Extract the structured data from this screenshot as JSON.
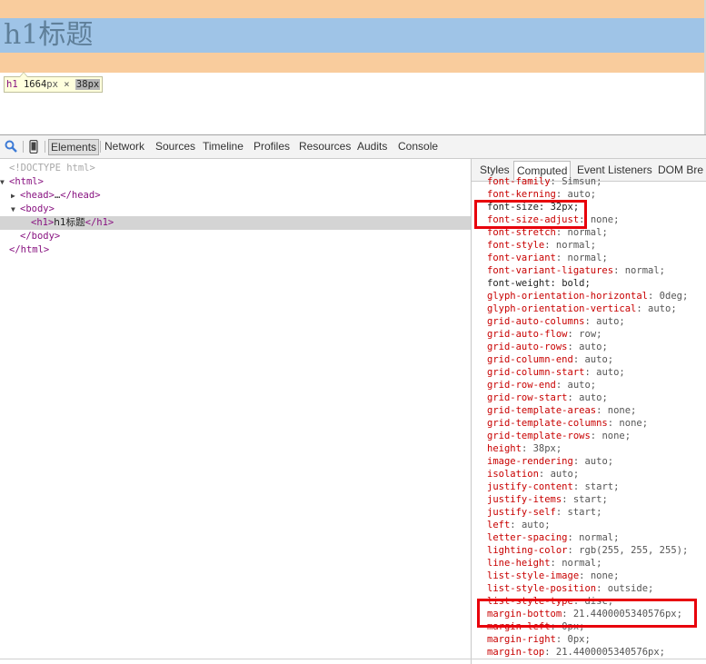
{
  "page": {
    "heading_text": "h1标题",
    "tooltip": {
      "tag": "h1",
      "width_value": "1664",
      "width_unit": "px",
      "times": "×",
      "height_value": "38px"
    }
  },
  "devtools": {
    "toolbar": {
      "tabs": [
        "Elements",
        "Network",
        "Sources",
        "Timeline",
        "Profiles",
        "Resources",
        "Audits",
        "Console"
      ],
      "selected_tab": "Elements"
    },
    "dom_tree": {
      "doctype": "<!DOCTYPE html>",
      "html_open": "<html>",
      "head_open": "<head>",
      "head_ellipsis": "…",
      "head_close": "</head>",
      "body_open": "<body>",
      "h1_open": "<h1>",
      "h1_text": "h1标题",
      "h1_close": "</h1>",
      "body_close": "</body>",
      "html_close": "</html>"
    },
    "sidebar_tabs": [
      "Styles",
      "Computed",
      "Event Listeners",
      "DOM Bre"
    ],
    "selected_sidebar_tab": "Computed",
    "computed_properties": [
      {
        "name": "font-family",
        "value": "Simsun;"
      },
      {
        "name": "font-kerning",
        "value": "auto;"
      },
      {
        "name": "font-size",
        "value": "32px;"
      },
      {
        "name": "font-size-adjust",
        "value": "none;"
      },
      {
        "name": "font-stretch",
        "value": "normal;"
      },
      {
        "name": "font-style",
        "value": "normal;"
      },
      {
        "name": "font-variant",
        "value": "normal;"
      },
      {
        "name": "font-variant-ligatures",
        "value": "normal;"
      },
      {
        "name": "font-weight",
        "value": "bold;"
      },
      {
        "name": "glyph-orientation-horizontal",
        "value": "0deg;"
      },
      {
        "name": "glyph-orientation-vertical",
        "value": "auto;"
      },
      {
        "name": "grid-auto-columns",
        "value": "auto;"
      },
      {
        "name": "grid-auto-flow",
        "value": "row;"
      },
      {
        "name": "grid-auto-rows",
        "value": "auto;"
      },
      {
        "name": "grid-column-end",
        "value": "auto;"
      },
      {
        "name": "grid-column-start",
        "value": "auto;"
      },
      {
        "name": "grid-row-end",
        "value": "auto;"
      },
      {
        "name": "grid-row-start",
        "value": "auto;"
      },
      {
        "name": "grid-template-areas",
        "value": "none;"
      },
      {
        "name": "grid-template-columns",
        "value": "none;"
      },
      {
        "name": "grid-template-rows",
        "value": "none;"
      },
      {
        "name": "height",
        "value": "38px;"
      },
      {
        "name": "image-rendering",
        "value": "auto;"
      },
      {
        "name": "isolation",
        "value": "auto;"
      },
      {
        "name": "justify-content",
        "value": "start;"
      },
      {
        "name": "justify-items",
        "value": "start;"
      },
      {
        "name": "justify-self",
        "value": "start;"
      },
      {
        "name": "left",
        "value": "auto;"
      },
      {
        "name": "letter-spacing",
        "value": "normal;"
      },
      {
        "name": "lighting-color",
        "value": "rgb(255, 255, 255);"
      },
      {
        "name": "line-height",
        "value": "normal;"
      },
      {
        "name": "list-style-image",
        "value": "none;"
      },
      {
        "name": "list-style-position",
        "value": "outside;"
      },
      {
        "name": "list-style-type",
        "value": "disc;"
      },
      {
        "name": "margin-bottom",
        "value": "21.4400005340576px;"
      },
      {
        "name": "margin-left",
        "value": "0px;"
      },
      {
        "name": "margin-right",
        "value": "0px;"
      },
      {
        "name": "margin-top",
        "value": "21.4400005340576px;"
      }
    ]
  },
  "colors": {
    "margin_overlay": "#f9cc9d",
    "content_overlay": "#9fc4e7",
    "highlight_box": "#e8000b",
    "property_name": "#c80000",
    "tag_color": "#881280"
  }
}
